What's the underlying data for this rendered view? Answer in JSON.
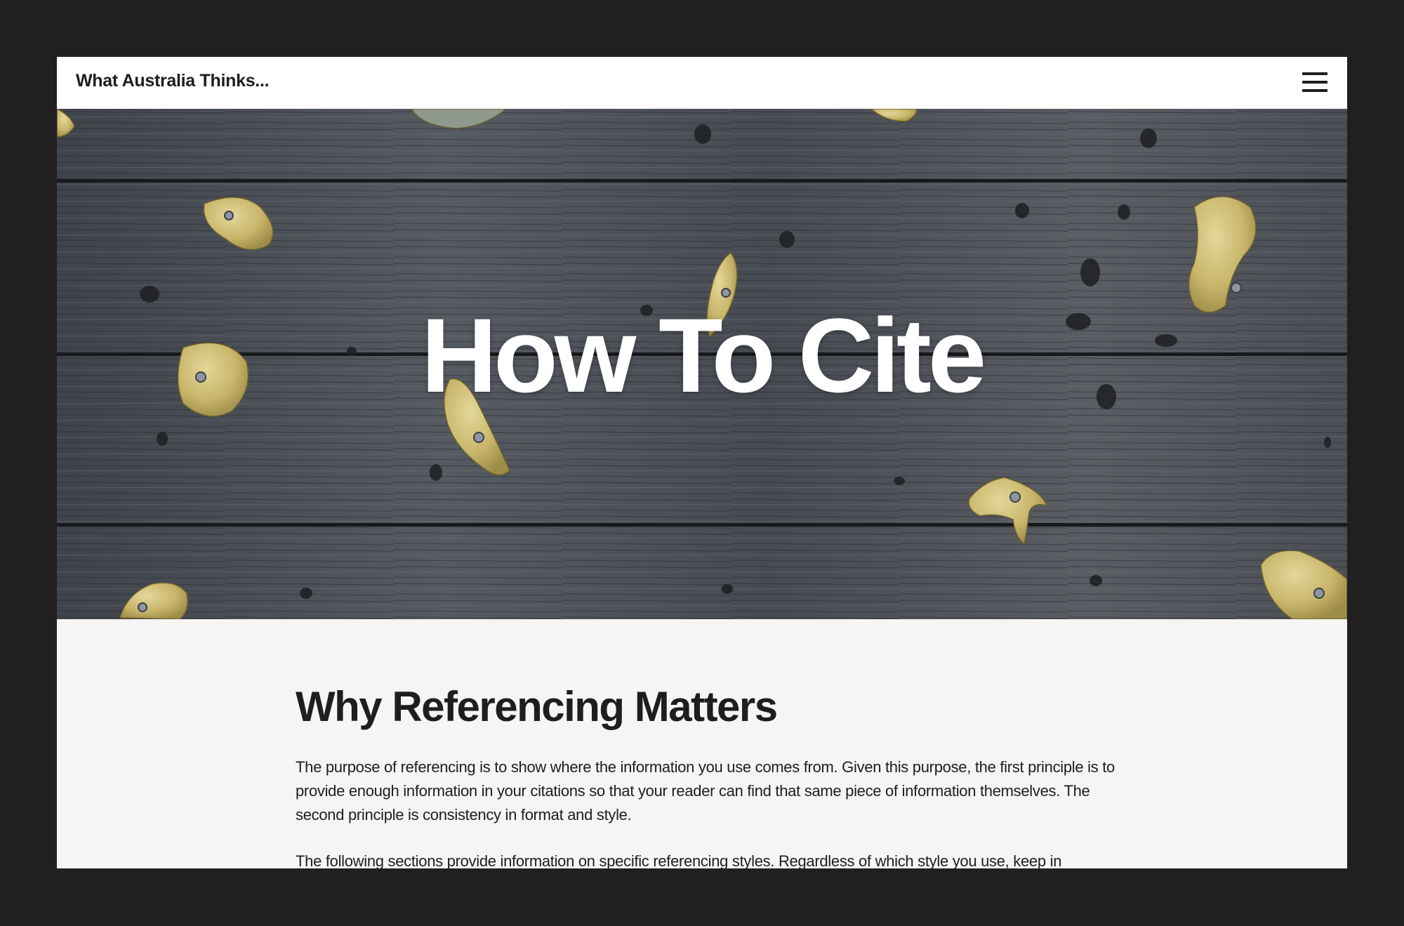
{
  "header": {
    "site_title": "What Australia Thinks...",
    "menu_icon": "hamburger-menu-icon"
  },
  "hero": {
    "title": "How To Cite",
    "background": "wooden-climbing-wall-with-holds"
  },
  "content": {
    "heading": "Why Referencing Matters",
    "paragraphs": [
      "The purpose of referencing is to show where the information you use comes from. Given this purpose, the first principle is to provide enough information in your citations so that your reader can find that same piece of information themselves. The second principle is consistency in format and style.",
      "The following sections provide information on specific referencing styles. Regardless of which style you use, keep in"
    ]
  },
  "colors": {
    "page_background": "#221f20",
    "header_background": "#ffffff",
    "content_background": "#f6f5f3",
    "text": "#1e1e1e",
    "hero_title": "#ffffff"
  }
}
